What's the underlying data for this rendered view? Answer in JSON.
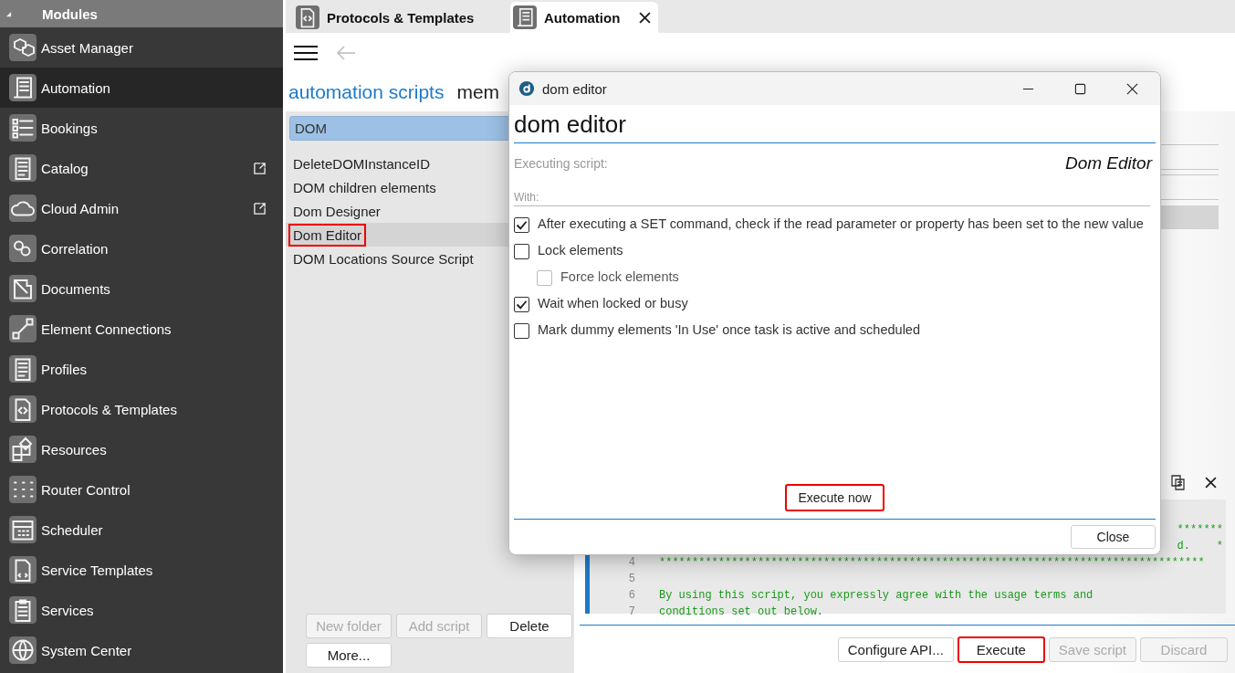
{
  "sidebar": {
    "title": "Modules",
    "items": [
      {
        "label": "Asset Manager",
        "selected": false,
        "external": false
      },
      {
        "label": "Automation",
        "selected": true,
        "external": false
      },
      {
        "label": "Bookings",
        "selected": false,
        "external": false
      },
      {
        "label": "Catalog",
        "selected": false,
        "external": true
      },
      {
        "label": "Cloud Admin",
        "selected": false,
        "external": true
      },
      {
        "label": "Correlation",
        "selected": false,
        "external": false
      },
      {
        "label": "Documents",
        "selected": false,
        "external": false
      },
      {
        "label": "Element Connections",
        "selected": false,
        "external": false
      },
      {
        "label": "Profiles",
        "selected": false,
        "external": false
      },
      {
        "label": "Protocols & Templates",
        "selected": false,
        "external": false
      },
      {
        "label": "Resources",
        "selected": false,
        "external": false
      },
      {
        "label": "Router Control",
        "selected": false,
        "external": false
      },
      {
        "label": "Scheduler",
        "selected": false,
        "external": false
      },
      {
        "label": "Service Templates",
        "selected": false,
        "external": false
      },
      {
        "label": "Services",
        "selected": false,
        "external": false
      },
      {
        "label": "System Center",
        "selected": false,
        "external": false
      }
    ]
  },
  "tabs": [
    {
      "label": "Protocols & Templates",
      "selected": false,
      "closable": false
    },
    {
      "label": "Automation",
      "selected": true,
      "closable": true
    }
  ],
  "headings": [
    {
      "label": "automation scripts",
      "selected": true
    },
    {
      "label": "mem",
      "selected": false
    }
  ],
  "folder": {
    "label": "DOM",
    "selected": true
  },
  "scripts": [
    {
      "label": "DeleteDOMInstanceID",
      "selected": false,
      "annotated": false
    },
    {
      "label": "DOM children elements",
      "selected": false,
      "annotated": false
    },
    {
      "label": "Dom Designer",
      "selected": false,
      "annotated": false
    },
    {
      "label": "Dom Editor",
      "selected": true,
      "annotated": true
    },
    {
      "label": "DOM Locations Source Script",
      "selected": false,
      "annotated": false
    }
  ],
  "list_buttons": [
    {
      "label": "New folder",
      "disabled": true
    },
    {
      "label": "Add script",
      "disabled": true
    },
    {
      "label": "Delete",
      "disabled": false
    },
    {
      "label": "More...",
      "disabled": false
    }
  ],
  "code_lines": [
    {
      "kind": "tail",
      "text": "*******"
    },
    {
      "kind": "tail",
      "text": "d.    *"
    },
    {
      "kind": "line",
      "number": "4",
      "text": "***********************************************************************************"
    },
    {
      "kind": "line",
      "number": "5"
    },
    {
      "kind": "line",
      "number": "6",
      "text": "By using this script, you expressly agree with the usage terms and"
    },
    {
      "kind": "line",
      "number": "7",
      "text": "conditions set out below."
    }
  ],
  "bottom_buttons": [
    {
      "label": "Configure API...",
      "disabled": false,
      "annotated": false
    },
    {
      "label": "Execute",
      "disabled": false,
      "annotated": true
    },
    {
      "label": "Save script",
      "disabled": true,
      "annotated": false
    },
    {
      "label": "Discard",
      "disabled": true,
      "annotated": false
    }
  ],
  "dialog": {
    "title": "dom editor",
    "heading": "dom editor",
    "executing_label": "Executing script:",
    "script_name": "Dom Editor",
    "with_label": "With:",
    "options": [
      {
        "label": "After executing a SET command, check if the read parameter or property has been set to the new value",
        "checked": true,
        "disabled": false
      },
      {
        "label": "Lock elements",
        "checked": false,
        "disabled": false,
        "children": [
          {
            "label": "Force lock elements",
            "checked": false,
            "disabled": true
          }
        ]
      },
      {
        "label": "Wait when locked or busy",
        "checked": true,
        "disabled": false
      },
      {
        "label": "Mark dummy elements 'In Use' once task is active and scheduled",
        "checked": false,
        "disabled": false
      }
    ],
    "execute_button": {
      "label": "Execute now",
      "annotated": true
    },
    "close_button": {
      "label": "Close"
    }
  }
}
